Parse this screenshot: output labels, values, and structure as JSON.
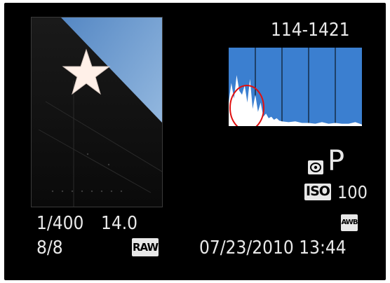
{
  "display": {
    "file_number": "114-1421",
    "shooting_mode": "P",
    "iso_label": "ISO",
    "iso_value": "100",
    "white_balance": "AWB",
    "shutter_speed": "1/400",
    "aperture": "14.0",
    "frame_counter": "8/8",
    "image_quality": "RAW",
    "date_time": "07/23/2010 13:44"
  },
  "icons": {
    "metering": "evaluative-metering-icon",
    "histogram_highlight": "red-circle-annotation"
  },
  "colors": {
    "screen_background": "#000000",
    "histogram_background": "#3b7fd0",
    "histogram_fill": "#ffffff",
    "annotation_circle": "#e01010",
    "text": "#e8e8e8",
    "photo_sky": "#7fb0e0",
    "star": "#fff0e8"
  },
  "chart_data": {
    "type": "area",
    "grid_columns": 5,
    "x": [
      0,
      2,
      4,
      6,
      8,
      10,
      12,
      14,
      16,
      18,
      20,
      22,
      24,
      26,
      28,
      30,
      32,
      34,
      36,
      38,
      40,
      45,
      50,
      55,
      60,
      65,
      70,
      75,
      80,
      85,
      90,
      95,
      100
    ],
    "values": [
      0.3,
      0.55,
      0.35,
      0.65,
      0.45,
      0.4,
      0.52,
      0.3,
      0.6,
      0.22,
      0.4,
      0.18,
      0.3,
      0.12,
      0.16,
      0.1,
      0.12,
      0.08,
      0.1,
      0.07,
      0.06,
      0.05,
      0.06,
      0.04,
      0.04,
      0.03,
      0.05,
      0.03,
      0.04,
      0.03,
      0.03,
      0.05,
      0.02
    ],
    "xlim": [
      0,
      100
    ],
    "ylim": [
      0,
      1
    ]
  }
}
